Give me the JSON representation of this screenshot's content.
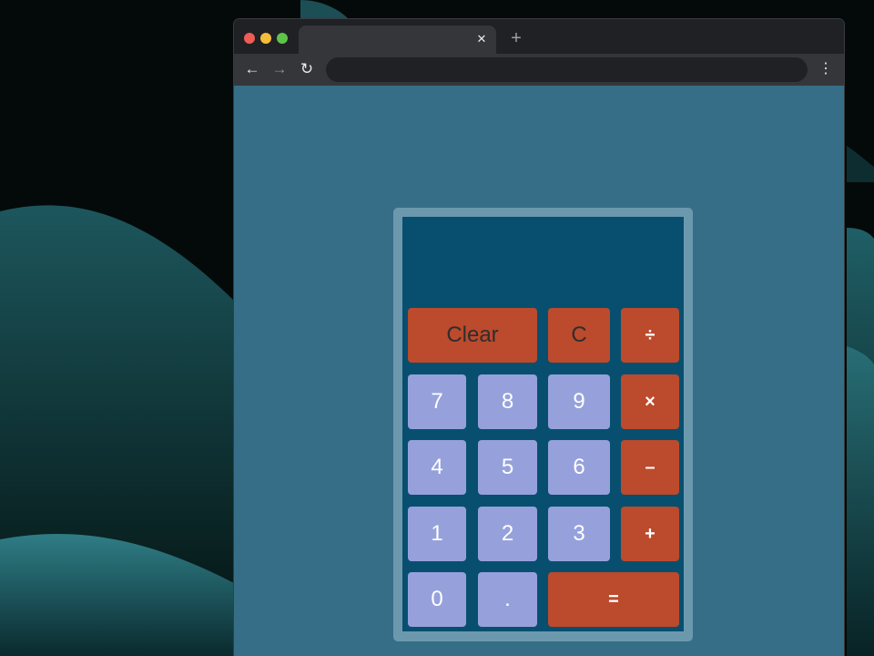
{
  "browser": {
    "tab": {
      "title": "",
      "close_glyph": "✕"
    },
    "new_tab_glyph": "+",
    "nav": {
      "back_glyph": "←",
      "forward_glyph": "→",
      "reload_glyph": "↻",
      "menu_glyph": "⋮"
    },
    "address_bar": {
      "value": ""
    }
  },
  "colors": {
    "page_background": "#366e87",
    "calculator_frame": "#6c98ae",
    "calculator_body": "#084f6f",
    "number_key": "#96a1dc",
    "operator_key": "#bc4a2c"
  },
  "calculator": {
    "display": "",
    "keys": {
      "clear": "Clear",
      "backspace": "C",
      "divide": "÷",
      "seven": "7",
      "eight": "8",
      "nine": "9",
      "multiply": "×",
      "four": "4",
      "five": "5",
      "six": "6",
      "subtract": "–",
      "one": "1",
      "two": "2",
      "three": "3",
      "add": "+",
      "zero": "0",
      "decimal": ".",
      "equals": "="
    }
  }
}
